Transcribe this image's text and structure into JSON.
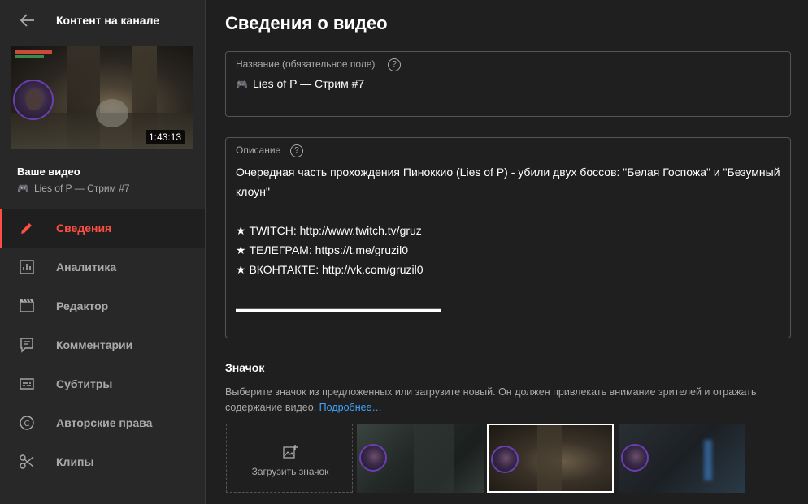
{
  "sidebar": {
    "title": "Контент на канале",
    "your_video_label": "Ваше видео",
    "video_title": "Lies of P — Стрим #7",
    "duration": "1:43:13",
    "nav": [
      {
        "label": "Сведения",
        "icon": "pencil-icon",
        "active": true
      },
      {
        "label": "Аналитика",
        "icon": "analytics-icon",
        "active": false
      },
      {
        "label": "Редактор",
        "icon": "editor-icon",
        "active": false
      },
      {
        "label": "Комментарии",
        "icon": "comments-icon",
        "active": false
      },
      {
        "label": "Субтитры",
        "icon": "subtitles-icon",
        "active": false
      },
      {
        "label": "Авторские права",
        "icon": "copyright-icon",
        "active": false
      },
      {
        "label": "Клипы",
        "icon": "scissors-icon",
        "active": false
      }
    ]
  },
  "main": {
    "page_title": "Сведения о видео",
    "title_field": {
      "label": "Название (обязательное поле)",
      "value": "Lies of P — Стрим #7"
    },
    "desc_field": {
      "label": "Описание",
      "value": "Очередная часть прохождения Пинoккио (Lies of P) - убили двух боссов: \"Белая Госпожа\" и \"Безумный клоун\"\n\n★ TWITCH: http://www.twitch.tv/gruz\n★ ТЕЛЕГРАМ: https://t.me/gruzil0\n★ ВКОНТАКТЕ: http://vk.com/gruzil0\n\n▬▬▬▬▬▬▬▬▬▬▬▬▬▬▬▬▬▬"
    },
    "thumbnail": {
      "heading": "Значок",
      "description": "Выберите значок из предложенных или загрузите новый. Он должен привлекать внимание зрителей и отражать содержание видео.",
      "learn_more": "Подробнее…",
      "upload_label": "Загрузить значок"
    }
  },
  "colors": {
    "accent": "#ff4e45",
    "link": "#3ea6ff",
    "background": "#1f1f1f",
    "sidebar": "#282828"
  }
}
